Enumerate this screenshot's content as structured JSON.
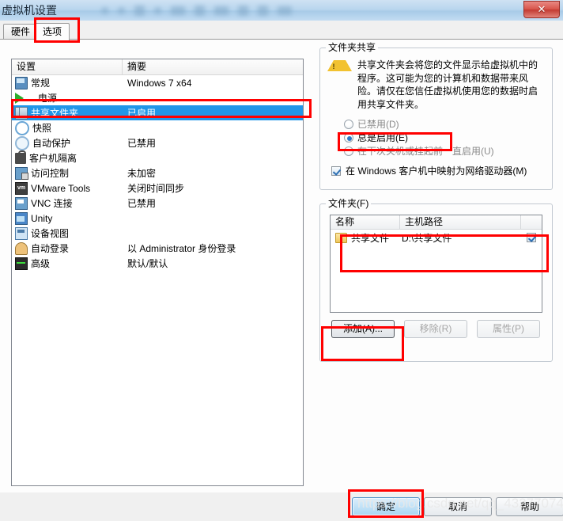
{
  "window": {
    "title": "虚拟机设置",
    "close_label": "✕"
  },
  "tabs": [
    {
      "label": "硬件",
      "selected": false
    },
    {
      "label": "选项",
      "selected": true
    }
  ],
  "settings_list": {
    "headers": {
      "name": "设置",
      "summary": "摘要"
    },
    "rows": [
      {
        "icon": "monitor-icon",
        "name": "常规",
        "summary": "Windows 7 x64",
        "selected": false
      },
      {
        "icon": "power-icon",
        "name": "电源",
        "summary": "",
        "selected": false
      },
      {
        "icon": "shared-folder-icon",
        "name": "共享文件夹",
        "summary": "已启用",
        "selected": true
      },
      {
        "icon": "snapshot-icon",
        "name": "快照",
        "summary": "",
        "selected": false
      },
      {
        "icon": "autoprotect-icon",
        "name": "自动保护",
        "summary": "已禁用",
        "selected": false
      },
      {
        "icon": "guest-isolation-icon",
        "name": "客户机隔离",
        "summary": "",
        "selected": false
      },
      {
        "icon": "access-control-icon",
        "name": "访问控制",
        "summary": "未加密",
        "selected": false
      },
      {
        "icon": "vmware-tools-icon",
        "name": "VMware Tools",
        "summary": "关闭时间同步",
        "selected": false
      },
      {
        "icon": "vnc-icon",
        "name": "VNC 连接",
        "summary": "已禁用",
        "selected": false
      },
      {
        "icon": "unity-icon",
        "name": "Unity",
        "summary": "",
        "selected": false
      },
      {
        "icon": "device-view-icon",
        "name": "设备视图",
        "summary": "",
        "selected": false
      },
      {
        "icon": "autologin-icon",
        "name": "自动登录",
        "summary": "以 Administrator 身份登录",
        "selected": false
      },
      {
        "icon": "advanced-icon",
        "name": "高级",
        "summary": "默认/默认",
        "selected": false
      }
    ]
  },
  "folder_sharing": {
    "group_label": "文件夹共享",
    "warning": "共享文件夹会将您的文件显示给虚拟机中的程序。这可能为您的计算机和数据带来风险。请仅在您信任虚拟机使用您的数据时启用共享文件夹。",
    "options": [
      {
        "label": "已禁用(D)",
        "checked": false,
        "disabled": true
      },
      {
        "label": "总是启用(E)",
        "checked": true,
        "disabled": false
      },
      {
        "label": "在下次关机或挂起前一直启用(U)",
        "checked": false,
        "disabled": true
      }
    ],
    "map_drive": {
      "label": "在 Windows 客户机中映射为网络驱动器(M)",
      "checked": true
    }
  },
  "folders": {
    "group_label": "文件夹(F)",
    "headers": {
      "name": "名称",
      "host_path": "主机路径",
      "enabled": ""
    },
    "rows": [
      {
        "name": "共享文件",
        "host_path": "D:\\共享文件",
        "enabled": true
      }
    ],
    "buttons": [
      {
        "label": "添加(A)...",
        "disabled": false
      },
      {
        "label": "移除(R)",
        "disabled": true
      },
      {
        "label": "属性(P)",
        "disabled": true
      }
    ]
  },
  "footer": {
    "ok": "确定",
    "cancel": "取消",
    "help": "帮助",
    "watermark": "https://blog.csdn.net/qq_43277074"
  },
  "colors": {
    "selection_blue": "#2196e8",
    "annotation_red": "#ff0000",
    "titlebar_blue": "#b9d6ee"
  }
}
